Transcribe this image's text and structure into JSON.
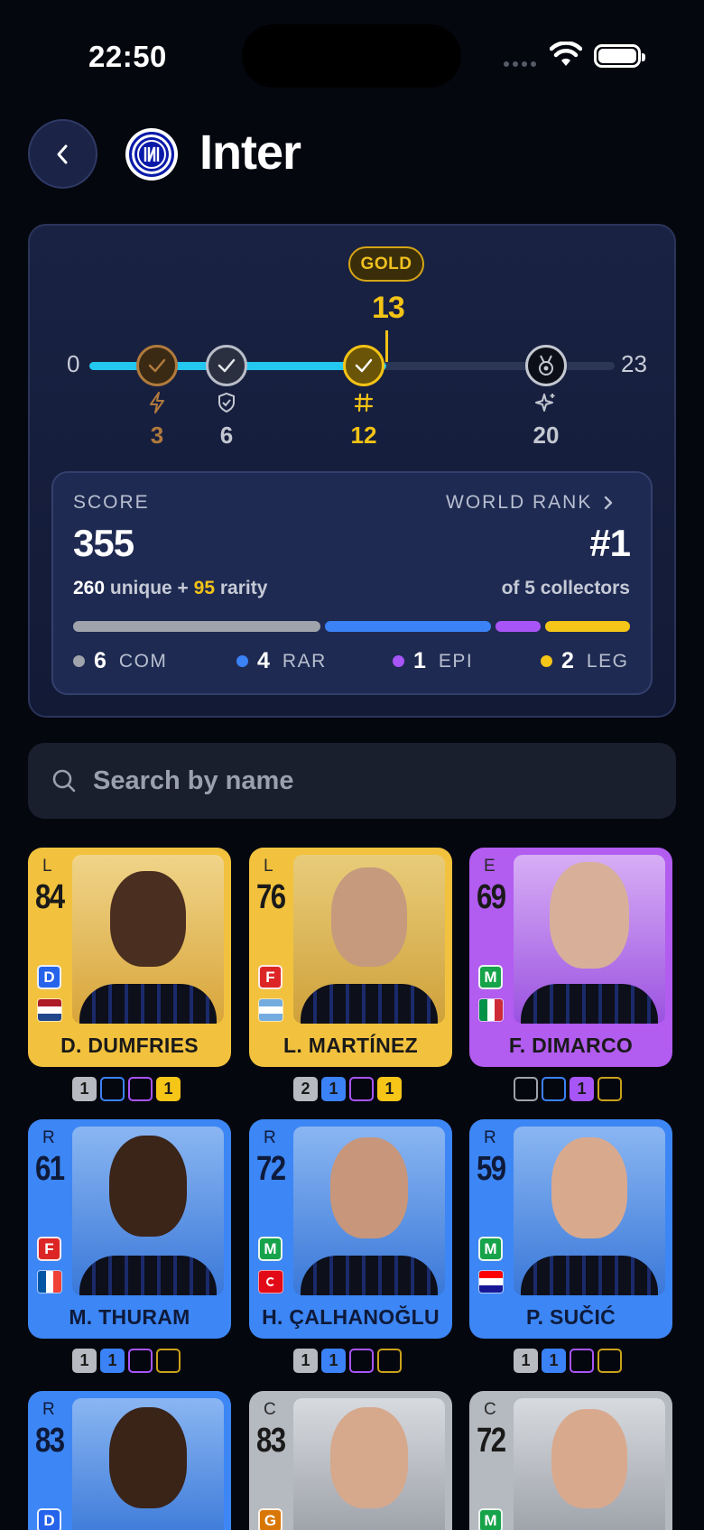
{
  "status_bar": {
    "time": "22:50"
  },
  "header": {
    "title": "Inter",
    "back_icon": "chevron-left-icon",
    "logo": "inter-crest"
  },
  "progress": {
    "tier": "GOLD",
    "current": "13",
    "min": "0",
    "max": "23",
    "fraction_filled": 0.565,
    "milestones": [
      {
        "value": "3",
        "icon": "lightning-icon",
        "color": "#b07a3c",
        "reached": true
      },
      {
        "value": "6",
        "icon": "shield-icon",
        "color": "#c3c7d0",
        "reached": true
      },
      {
        "value": "12",
        "icon": "hash-icon",
        "color": "#f3c315",
        "reached": true
      },
      {
        "value": "20",
        "icon": "sparkle-icon",
        "color": "#c3c7d0",
        "reached": false
      }
    ]
  },
  "score": {
    "label": "SCORE",
    "value": "355",
    "breakdown_unique": "260",
    "breakdown_unique_text": "unique +",
    "breakdown_rarity": "95",
    "breakdown_rarity_text": "rarity",
    "rank_label": "WORLD RANK",
    "rank_value": "#1",
    "rank_sub": "of 5 collectors",
    "legend": [
      {
        "count": "6",
        "abbr": "COM",
        "color": "#9fa3ab"
      },
      {
        "count": "4",
        "abbr": "RAR",
        "color": "#3b82f6"
      },
      {
        "count": "1",
        "abbr": "EPI",
        "color": "#a855f7"
      },
      {
        "count": "2",
        "abbr": "LEG",
        "color": "#f5c518"
      }
    ]
  },
  "search": {
    "placeholder": "Search by name"
  },
  "players": [
    {
      "name": "D. DUMFRIES",
      "rarity": "L",
      "overall": "84",
      "position": "D",
      "pos_color": "#2563eb",
      "flag": "nl",
      "counts": [
        "1",
        "",
        "",
        "1"
      ]
    },
    {
      "name": "L. MARTÍNEZ",
      "rarity": "L",
      "overall": "76",
      "position": "F",
      "pos_color": "#dc2626",
      "flag": "ar",
      "counts": [
        "2",
        "1",
        "",
        "1"
      ]
    },
    {
      "name": "F. DIMARCO",
      "rarity": "E",
      "overall": "69",
      "position": "M",
      "pos_color": "#16a34a",
      "flag": "it",
      "counts": [
        "",
        "",
        "1",
        ""
      ]
    },
    {
      "name": "M. THURAM",
      "rarity": "R",
      "overall": "61",
      "position": "F",
      "pos_color": "#dc2626",
      "flag": "fr",
      "counts": [
        "1",
        "1",
        "",
        ""
      ]
    },
    {
      "name": "H. ÇALHANOĞLU",
      "rarity": "R",
      "overall": "72",
      "position": "M",
      "pos_color": "#16a34a",
      "flag": "tr",
      "counts": [
        "1",
        "1",
        "",
        ""
      ]
    },
    {
      "name": "P. SUČIĆ",
      "rarity": "R",
      "overall": "59",
      "position": "M",
      "pos_color": "#16a34a",
      "flag": "hr",
      "counts": [
        "1",
        "1",
        "",
        ""
      ]
    },
    {
      "name": "",
      "rarity": "R",
      "overall": "83",
      "position": "D",
      "pos_color": "#2563eb",
      "flag": "",
      "counts": []
    },
    {
      "name": "",
      "rarity": "C",
      "overall": "83",
      "position": "G",
      "pos_color": "#d97706",
      "flag": "",
      "counts": []
    },
    {
      "name": "",
      "rarity": "C",
      "overall": "72",
      "position": "M",
      "pos_color": "#16a34a",
      "flag": "",
      "counts": []
    }
  ]
}
